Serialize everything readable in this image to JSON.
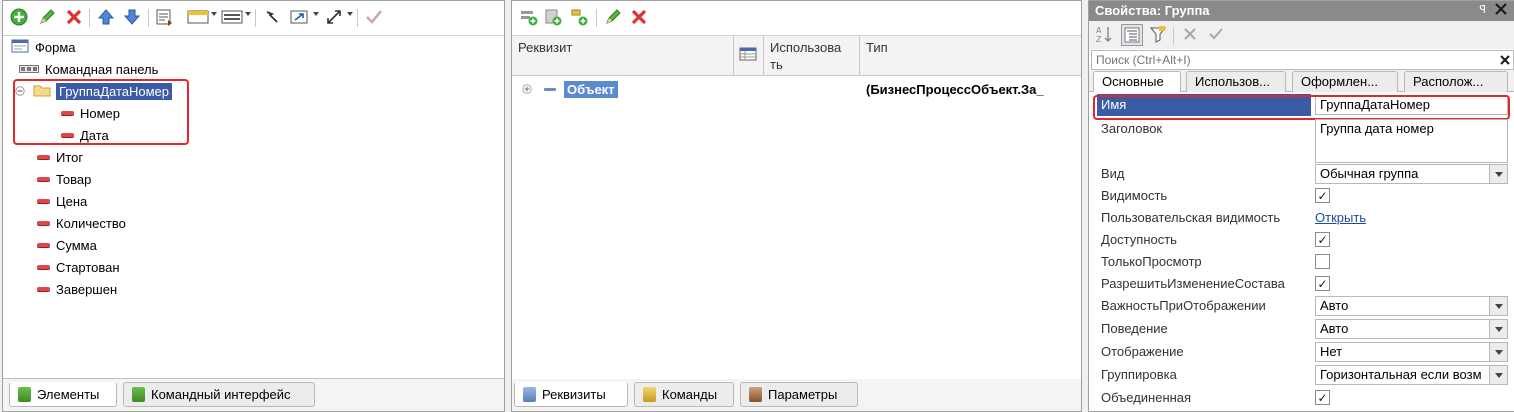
{
  "left_panel": {
    "tree": [
      {
        "label": "Форма",
        "icon": "form-icon"
      },
      {
        "label": "Командная панель",
        "icon": "command-panel-icon"
      },
      {
        "label": "ГруппаДатаНомер",
        "icon": "folder-icon",
        "selected": true,
        "expanded": true
      },
      {
        "label": "Номер",
        "icon": "field-icon"
      },
      {
        "label": "Дата",
        "icon": "field-icon"
      },
      {
        "label": "Итог",
        "icon": "field-icon"
      },
      {
        "label": "Товар",
        "icon": "field-icon"
      },
      {
        "label": "Цена",
        "icon": "field-icon"
      },
      {
        "label": "Количество",
        "icon": "field-icon"
      },
      {
        "label": "Сумма",
        "icon": "field-icon"
      },
      {
        "label": "Стартован",
        "icon": "field-icon"
      },
      {
        "label": "Завершен",
        "icon": "field-icon"
      }
    ],
    "tabs": [
      {
        "label": "Элементы",
        "active": true
      },
      {
        "label": "Командный интерфейс",
        "active": false
      }
    ]
  },
  "mid_panel": {
    "columns": {
      "requisite": "Реквизит",
      "usage_line1": "Использова",
      "usage_line2": "ть",
      "type": "Тип"
    },
    "rows": [
      {
        "name": "Объект",
        "type": "(БизнесПроцессОбъект.За_"
      }
    ],
    "tabs": [
      {
        "label": "Реквизиты",
        "active": true
      },
      {
        "label": "Команды",
        "active": false
      },
      {
        "label": "Параметры",
        "active": false
      }
    ]
  },
  "props_panel": {
    "title": "Свойства: Группа",
    "pin_label": "ꟼ",
    "search_placeholder": "Поиск (Ctrl+Alt+I)",
    "tabs": [
      "Основные",
      "Использов...",
      "Оформлен...",
      "Располож..."
    ],
    "rows": [
      {
        "name": "Имя",
        "kind": "text",
        "value": "ГруппаДатаНомер",
        "highlight": true
      },
      {
        "name": "Заголовок",
        "kind": "textarea",
        "value": "Группа дата номер"
      },
      {
        "name": "Вид",
        "kind": "select",
        "value": "Обычная группа"
      },
      {
        "name": "Видимость",
        "kind": "check",
        "checked": true
      },
      {
        "name": "Пользовательская видимость",
        "kind": "link",
        "value": "Открыть"
      },
      {
        "name": "Доступность",
        "kind": "check",
        "checked": true
      },
      {
        "name": "ТолькоПросмотр",
        "kind": "check",
        "checked": false
      },
      {
        "name": "РазрешитьИзменениеСостава",
        "kind": "check",
        "checked": true
      },
      {
        "name": "ВажностьПриОтображении",
        "kind": "select",
        "value": "Авто"
      },
      {
        "name": "Поведение",
        "kind": "select",
        "value": "Авто"
      },
      {
        "name": "Отображение",
        "kind": "select",
        "value": "Нет"
      },
      {
        "name": "Группировка",
        "kind": "select",
        "value": "Горизонтальная если возм"
      },
      {
        "name": "Объединенная",
        "kind": "check",
        "checked": true
      }
    ]
  },
  "colors": {
    "selection": "#3b5ba5",
    "highlight": "#e0282e",
    "selected_cell": "#5a8ad0"
  }
}
